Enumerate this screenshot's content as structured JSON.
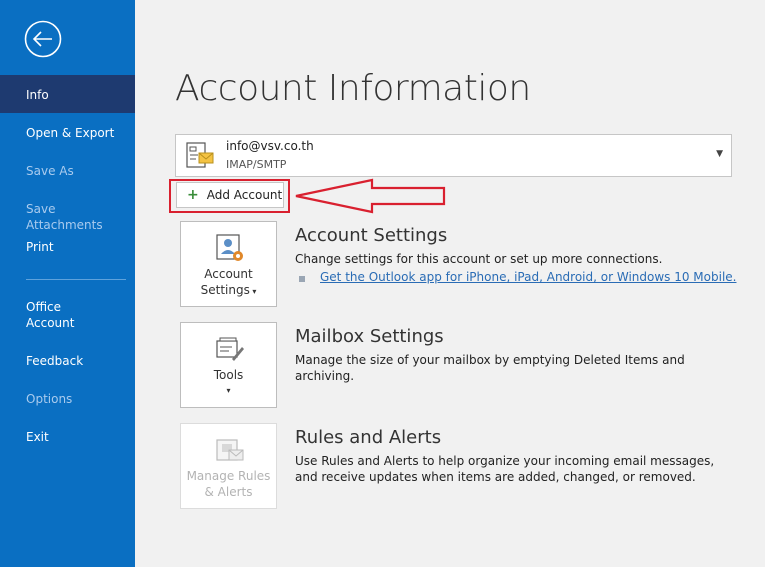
{
  "sidebar": {
    "items": [
      {
        "label": "Info"
      },
      {
        "label": "Open & Export"
      },
      {
        "label": "Save As"
      },
      {
        "label": "Save Attachments"
      },
      {
        "label": "Print"
      },
      {
        "label_line1": "Office",
        "label_line2": "Account"
      },
      {
        "label": "Feedback"
      },
      {
        "label": "Options"
      },
      {
        "label": "Exit"
      }
    ]
  },
  "main": {
    "title": "Account Information",
    "account": {
      "email": "info@vsv.co.th",
      "type": "IMAP/SMTP"
    },
    "add_account_label": "Add Account",
    "sections": [
      {
        "tile_line1": "Account",
        "tile_line2": "Settings",
        "title": "Account Settings",
        "description": "Change settings for this account or set up more connections.",
        "link": "Get the Outlook app for iPhone, iPad, Android, or Windows 10 Mobile."
      },
      {
        "tile_line1": "Tools",
        "title": "Mailbox Settings",
        "description": "Manage the size of your mailbox by emptying Deleted Items and archiving."
      },
      {
        "tile_line1": "Manage Rules",
        "tile_line2": "& Alerts",
        "title": "Rules and Alerts",
        "description": "Use Rules and Alerts to help organize your incoming email messages, and receive updates when items are added, changed, or removed."
      }
    ]
  },
  "colors": {
    "sidebar": "#0a6fc2",
    "active_item": "#1e3a70",
    "annotation": "#d9202f",
    "link": "#2a6cb5"
  },
  "icons": [
    "back-arrow-icon",
    "account-card-icon",
    "chevron-down-icon",
    "plus-icon",
    "account-settings-icon",
    "tools-icon",
    "rules-alerts-icon"
  ]
}
